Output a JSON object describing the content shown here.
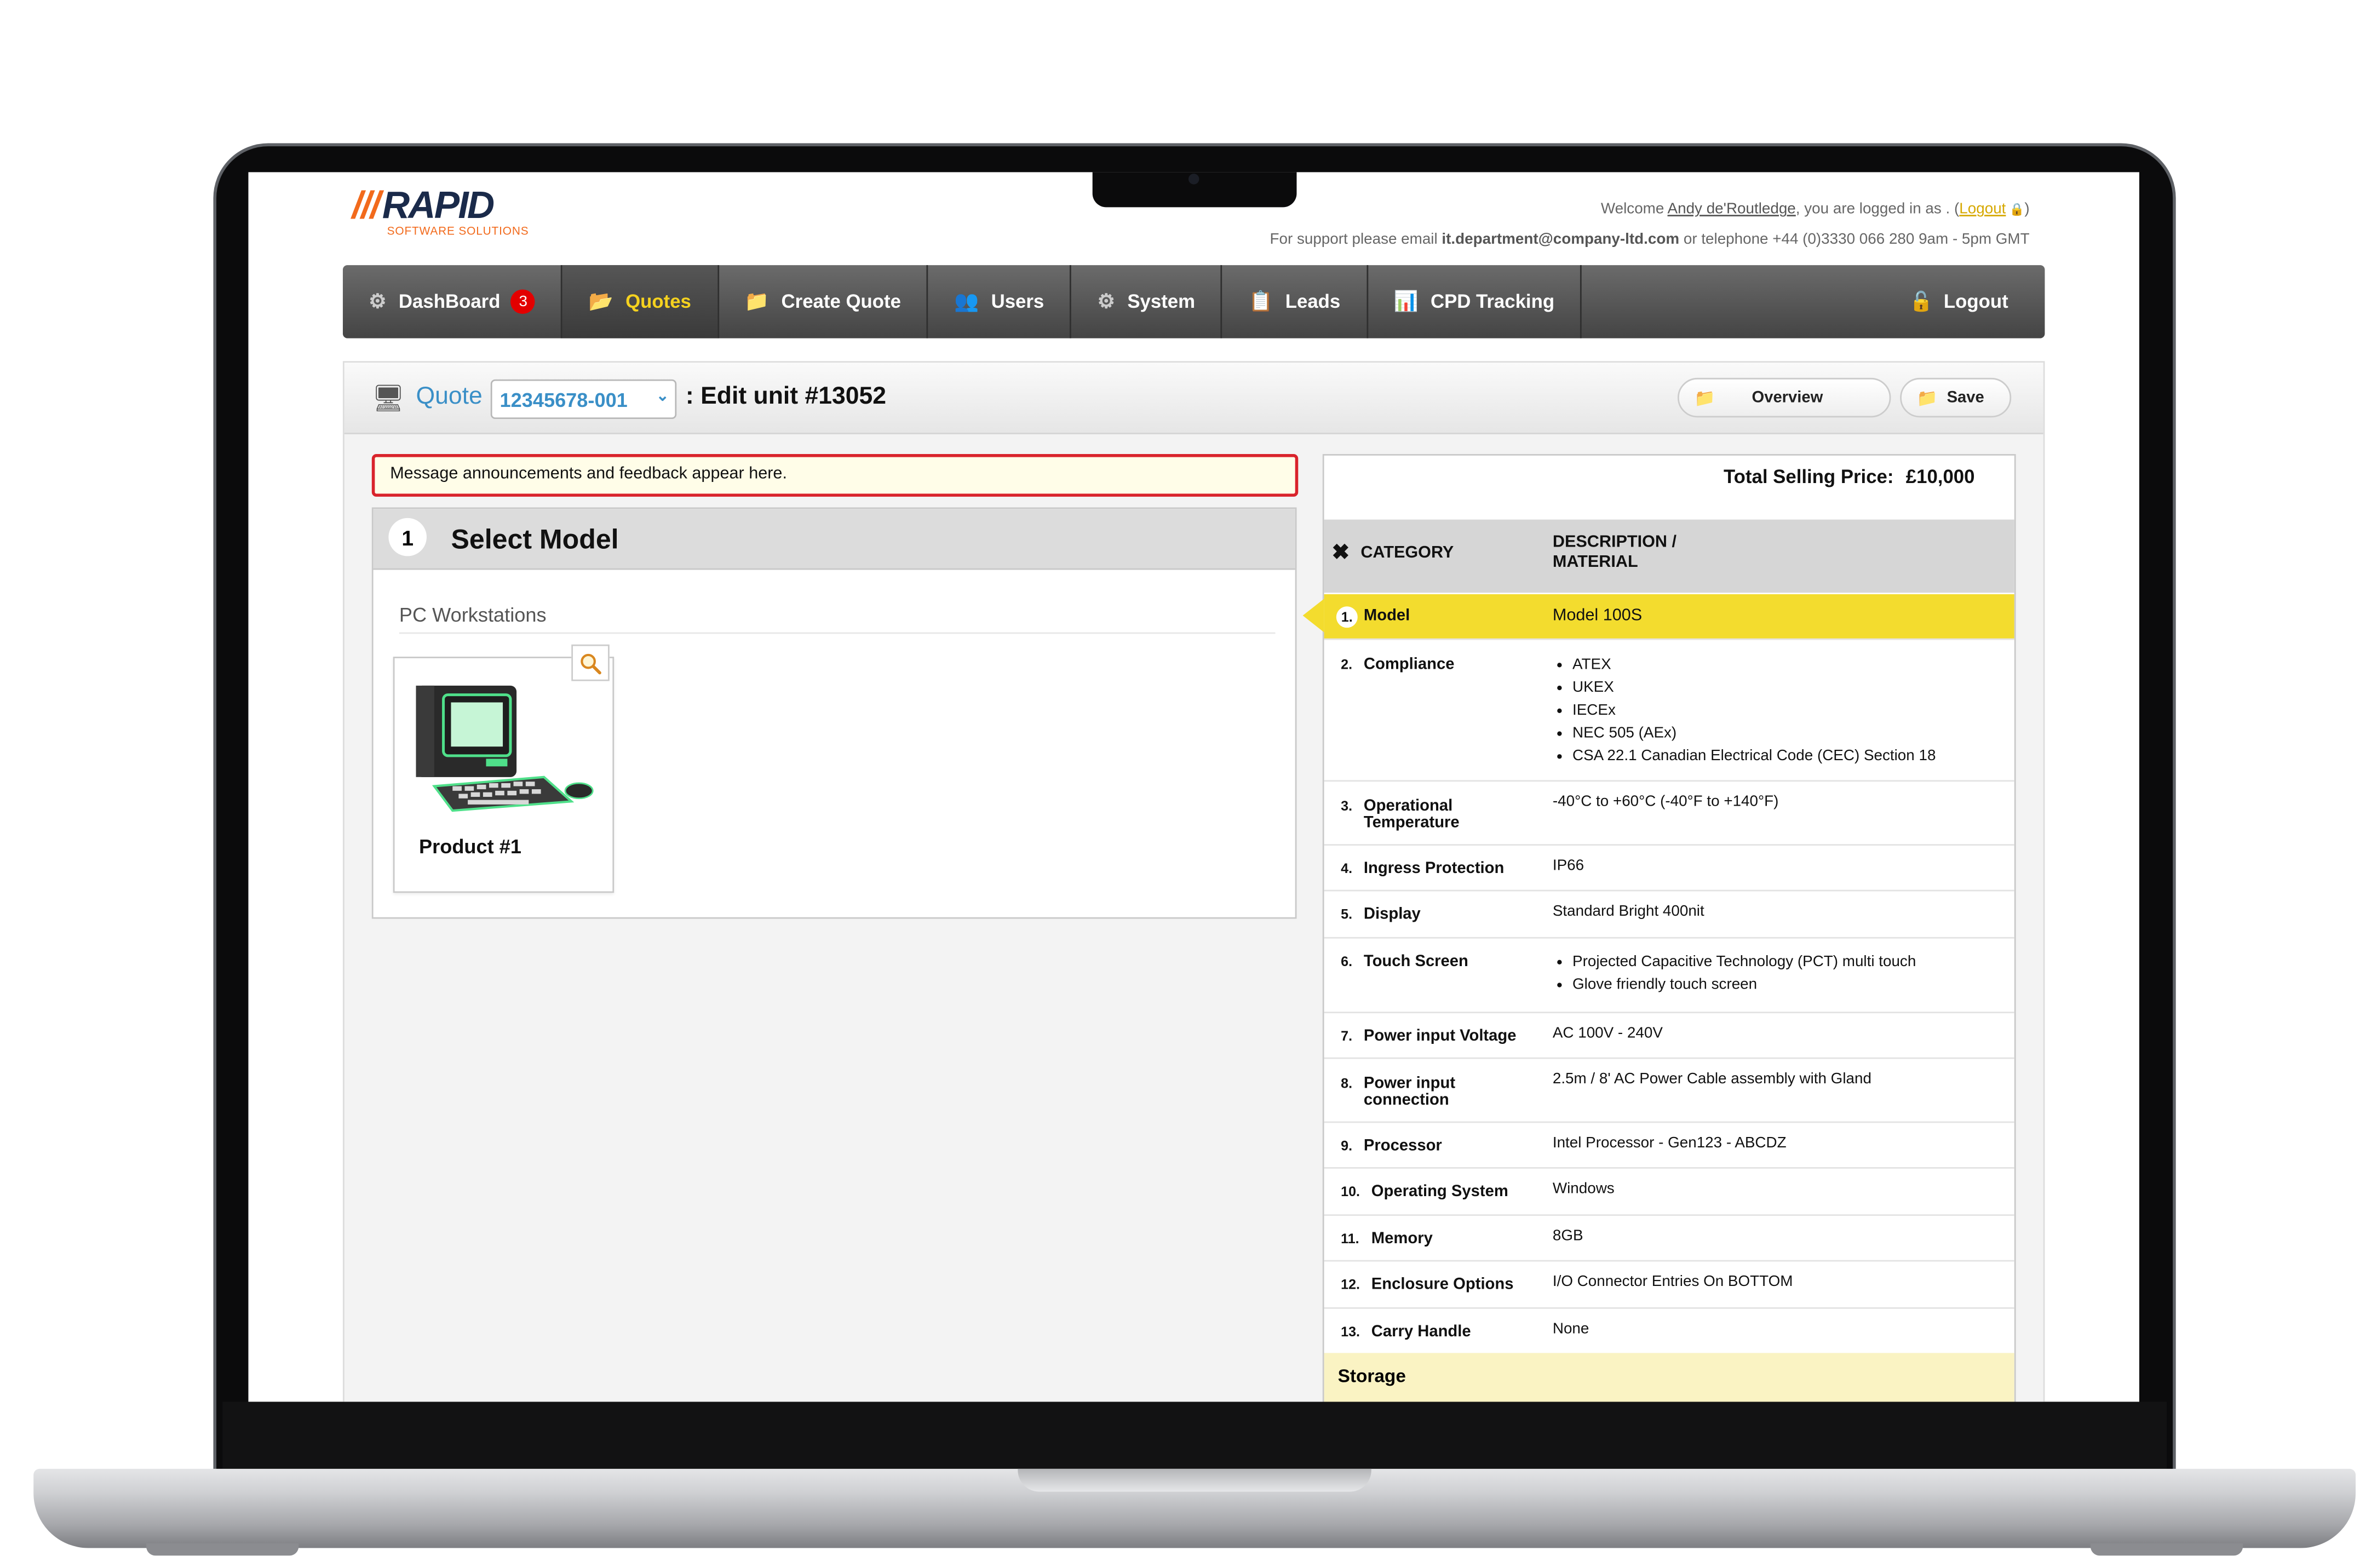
{
  "header": {
    "logo_text": "RAPID",
    "logo_slashes": "///",
    "logo_subtitle": "SOFTWARE SOLUTIONS",
    "welcome_prefix": "Welcome",
    "user_name": "Andy de'Routledge",
    "welcome_suffix": ", you are logged in as . (",
    "logout_link": "Logout",
    "welcome_end": ")",
    "support_prefix": "For support please email",
    "support_email": "it.department@company-ltd.com",
    "support_suffix": "or telephone +44 (0)3330 066 280 9am - 5pm GMT"
  },
  "nav": {
    "items": [
      {
        "label": "DashBoard",
        "icon": "dashboard-icon",
        "badge": "3"
      },
      {
        "label": "Quotes",
        "icon": "folder-icon",
        "active": true
      },
      {
        "label": "Create Quote",
        "icon": "folder-plus-icon"
      },
      {
        "label": "Users",
        "icon": "users-icon"
      },
      {
        "label": "System",
        "icon": "gears-icon"
      },
      {
        "label": "Leads",
        "icon": "contact-card-icon"
      },
      {
        "label": "CPD Tracking",
        "icon": "chart-icon"
      }
    ],
    "logout_label": "Logout",
    "active_color": "#f5d21f"
  },
  "titlebar": {
    "quote_label": "Quote",
    "quote_number": "12345678-001",
    "edit_label": ": Edit unit #13052",
    "overview_button": "Overview",
    "save_button": "Save"
  },
  "message": "Message announcements and feedback appear here.",
  "model_panel": {
    "step": "1",
    "title": "Select Model",
    "group": "PC Workstations",
    "product_name": "Product #1"
  },
  "spec": {
    "total_label": "Total Selling Price:",
    "total_value": "£10,000",
    "col_category": "CATEGORY",
    "col_description": "DESCRIPTION / MATERIAL",
    "rows": [
      {
        "num": "1.",
        "category": "Model",
        "description": "Model 100S"
      },
      {
        "num": "2.",
        "category": "Compliance",
        "list": [
          "ATEX",
          "UKEX",
          "IECEx",
          "NEC 505 (AEx)",
          "CSA 22.1 Canadian Electrical Code (CEC) Section 18"
        ]
      },
      {
        "num": "3.",
        "category": "Operational Temperature",
        "description": "-40°C to +60°C (-40°F to +140°F)"
      },
      {
        "num": "4.",
        "category": "Ingress Protection",
        "description": "IP66"
      },
      {
        "num": "5.",
        "category": "Display",
        "description": "Standard Bright 400nit"
      },
      {
        "num": "6.",
        "category": "Touch Screen",
        "list": [
          "Projected Capacitive Technology (PCT) multi touch",
          "Glove friendly touch screen"
        ]
      },
      {
        "num": "7.",
        "category": "Power input Voltage",
        "description": "AC 100V - 240V"
      },
      {
        "num": "8.",
        "category": "Power input connection",
        "description": "2.5m / 8' AC Power Cable assembly with Gland"
      },
      {
        "num": "9.",
        "category": "Processor",
        "description": "Intel Processor - Gen123 - ABCDZ"
      },
      {
        "num": "10.",
        "category": "Operating System",
        "description": "Windows"
      },
      {
        "num": "11.",
        "category": "Memory",
        "description": "8GB"
      },
      {
        "num": "12.",
        "category": "Enclosure Options",
        "description": "I/O Connector Entries On BOTTOM"
      },
      {
        "num": "13.",
        "category": "Carry Handle",
        "description": "None"
      }
    ],
    "section_storage": "Storage",
    "highlight_color": "#f3dc2e"
  }
}
